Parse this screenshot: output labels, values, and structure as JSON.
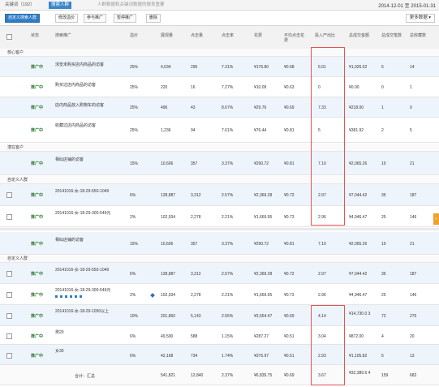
{
  "tabs": {
    "t1": "关键词（192）",
    "t2": "搜索人群",
    "t3": "人群数据和关键词数据的报表重要",
    "date": "2014-12-01 至 2015-01-31"
  },
  "toolbar": {
    "b1": "自定义搜索人群",
    "b2": "修改溢价",
    "b3": "参与推广",
    "b4": "暂停推广",
    "b5": "删除",
    "more": "更多数据"
  },
  "cols": [
    "状态",
    "搜索推广",
    "溢价",
    "展现量",
    "点击量",
    "点击率",
    "花费",
    "平均点击花费",
    "投入产出比",
    "总成交金额",
    "总成交笔数",
    "总收藏数"
  ],
  "groups": {
    "g1": "核心客户",
    "g2": "潜在客户",
    "g3": "自定义人群",
    "g4": "自定义人群"
  },
  "rows": [
    {
      "s": "推广中",
      "n": "浏览未购买店内商品的访客",
      "p": "25%",
      "v": "4,034",
      "c": "295",
      "r": "7.31%",
      "f": "¥176.80",
      "a": "¥0.58",
      "roi": "6.01",
      "t": "¥1,026.02",
      "o": "5",
      "k": "14"
    },
    {
      "s": "推广中",
      "n": "购买过店内商品的访客",
      "p": "25%",
      "v": "220",
      "c": "16",
      "r": "7.27%",
      "f": "¥10.09",
      "a": "¥0.63",
      "roi": "0",
      "t": "¥0.00",
      "o": "0",
      "k": "1"
    },
    {
      "s": "推广中",
      "n": "店内商品放入购物车的访客",
      "p": "25%",
      "v": "496",
      "c": "43",
      "r": "8.67%",
      "f": "¥29.76",
      "a": "¥0.69",
      "roi": "7.33",
      "t": "¥218.00",
      "o": "1",
      "k": "0"
    },
    {
      "s": "推广中",
      "n": "收藏过店内商品的访客",
      "p": "25%",
      "v": "1,236",
      "c": "94",
      "r": "7.61%",
      "f": "¥76.44",
      "a": "¥0.81",
      "roi": "5",
      "t": "¥381.92",
      "o": "2",
      "k": "5"
    },
    {
      "s": "推广中",
      "n": "相似店铺的访客",
      "p": "15%",
      "v": "10,606",
      "c": "357",
      "r": "3.37%",
      "f": "¥290.72",
      "a": "¥0.81",
      "roi": "7.10",
      "t": "¥2,065.26",
      "o": "10",
      "k": "21"
    },
    {
      "s": "推广中",
      "n": "20141016-女-18-29-550-1049",
      "p": "6%",
      "v": "128,887",
      "c": "3,312",
      "r": "2.57%",
      "f": "¥2,369.28",
      "a": "¥0.72",
      "roi": "2.97",
      "t": "¥7,044.42",
      "o": "35",
      "k": "187"
    },
    {
      "s": "推广中",
      "n": "20141016-女-18-29-300-549元",
      "p": "2%",
      "v": "102,934",
      "c": "2,278",
      "r": "2.21%",
      "f": "¥1,669.95",
      "a": "¥0.73",
      "roi": "2.96",
      "t": "¥4,946.47",
      "o": "25",
      "k": "146"
    },
    {
      "s": "推广中",
      "n": "相似店铺的访客",
      "p": "15%",
      "v": "10,606",
      "c": "357",
      "r": "3.37%",
      "f": "¥290.72",
      "a": "¥0.81",
      "roi": "7.10",
      "t": "¥2,065.26",
      "o": "10",
      "k": "21"
    },
    {
      "s": "推广中",
      "n": "20141016-女-18-29-550-1049",
      "p": "6%",
      "v": "128,887",
      "c": "3,312",
      "r": "2.57%",
      "f": "¥2,369.28",
      "a": "¥0.72",
      "roi": "2.97",
      "t": "¥7,044.42",
      "o": "35",
      "k": "187"
    },
    {
      "s": "推广中",
      "n": "20141016-女-18-29-300-549元",
      "p": "2%",
      "v": "102,934",
      "c": "2,278",
      "r": "2.21%",
      "f": "¥1,669.95",
      "a": "¥0.73",
      "roi": "2.96",
      "t": "¥4,946.47",
      "o": "25",
      "k": "146"
    },
    {
      "s": "推广中",
      "n": "20141016-女-18-29-1050以上",
      "p": "10%",
      "v": "201,860",
      "c": "5,143",
      "r": "2.55%",
      "f": "¥3,554.47",
      "a": "¥0.69",
      "roi": "4.14",
      "t": "¥14,730.0 3",
      "o": "72",
      "k": "275"
    },
    {
      "s": "推广中",
      "n": "男20",
      "p": "6%",
      "v": "49,590",
      "c": "588",
      "r": "1.15%",
      "f": "¥287.27",
      "a": "¥0.51",
      "roi": "3.04",
      "t": "¥872.00",
      "o": "4",
      "k": "20"
    },
    {
      "s": "推广中",
      "n": "女30",
      "p": "6%",
      "v": "42,168",
      "c": "734",
      "r": "1.74%",
      "f": "¥376.97",
      "a": "¥0.51",
      "roi": "2.93",
      "t": "¥1,105.82",
      "o": "5",
      "k": "13"
    }
  ],
  "total": {
    "label": "合计：汇总",
    "v": "541,821",
    "c": "12,840",
    "r": "2.37%",
    "f": "¥6,835.75",
    "a": "¥0.69",
    "roi": "3.67",
    "t": "¥32,389.6 4",
    "o": "159",
    "k": "682"
  }
}
